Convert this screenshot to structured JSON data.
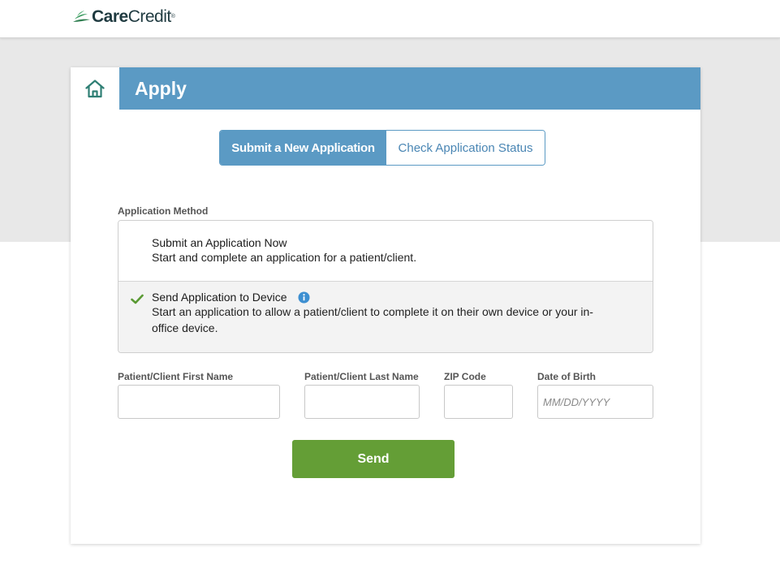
{
  "brand": {
    "logo_bold": "Care",
    "logo_regular": "Credit",
    "logo_tm": "®"
  },
  "header": {
    "title": "Apply",
    "home_icon": "home-icon"
  },
  "tabs": {
    "active_label": "Submit a New Application",
    "inactive_label": "Check Application Status"
  },
  "method": {
    "label": "Application Method",
    "options": [
      {
        "title": "Submit an Application Now",
        "description": "Start and complete an application for a patient/client.",
        "selected": false
      },
      {
        "title": "Send Application to Device",
        "description": "Start an application to allow a patient/client to complete it on their own device or your in-office device.",
        "selected": true,
        "icon": "info-icon"
      }
    ]
  },
  "form": {
    "first_name": {
      "label": "Patient/Client First Name",
      "value": "",
      "placeholder": ""
    },
    "last_name": {
      "label": "Patient/Client Last Name",
      "value": "",
      "placeholder": ""
    },
    "zip": {
      "label": "ZIP Code",
      "value": "",
      "placeholder": ""
    },
    "dob": {
      "label": "Date of Birth",
      "value": "",
      "placeholder": "MM/DD/YYYY"
    },
    "send_label": "Send"
  },
  "colors": {
    "header_blue": "#5b9ac4",
    "send_green": "#649e36",
    "check_green": "#5a9a34",
    "logo_green": "#2e7d4f"
  }
}
